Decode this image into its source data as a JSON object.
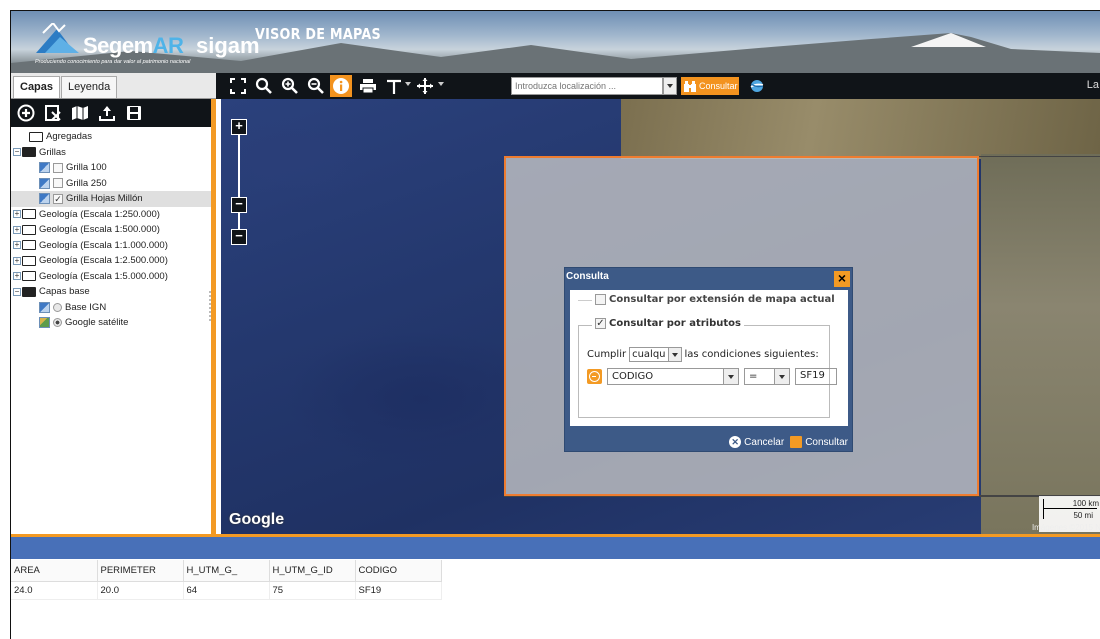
{
  "header": {
    "logo_segem": "Segem",
    "logo_ar": "AR",
    "logo_sigam": "sigam",
    "logo_tagline": "Produciendo conocimiento para dar valor al patrimonio nacional",
    "visor_title": "VISOR DE MAPAS"
  },
  "tabs": [
    {
      "label": "Capas"
    },
    {
      "label": "Leyenda"
    }
  ],
  "toolbar": {
    "location_placeholder": "Introduzca localización ...",
    "consultar_label": "Consultar",
    "right_truncated": "La"
  },
  "tree": [
    {
      "label": "Agregadas"
    },
    {
      "label": "Grillas"
    },
    {
      "label": "Grilla 100"
    },
    {
      "label": "Grilla 250"
    },
    {
      "label": "Grilla Hojas Millón"
    },
    {
      "label": "Geología (Escala 1:250.000)"
    },
    {
      "label": "Geología (Escala 1:500.000)"
    },
    {
      "label": "Geología (Escala 1:1.000.000)"
    },
    {
      "label": "Geología (Escala 1:2.500.000)"
    },
    {
      "label": "Geología (Escala 1:5.000.000)"
    },
    {
      "label": "Capas base"
    },
    {
      "label": "Base IGN"
    },
    {
      "label": "Google satélite"
    }
  ],
  "map": {
    "google_logo": "Google",
    "scale_km": "100 km",
    "scale_mi": "50 mi",
    "credit": "Imágenes ©2015 N"
  },
  "dialog": {
    "title": "Consulta",
    "opt_extent": "Consultar por extensión de mapa actual",
    "opt_attr": "Consultar por atributos",
    "cumplir": "Cumplir",
    "cumplir_value": "cualqu",
    "conditions_text": "las condiciones siguientes:",
    "field": "CODIGO",
    "operator": "=",
    "value": "SF19",
    "cancel": "Cancelar",
    "submit": "Consultar"
  },
  "results": {
    "columns": [
      "AREA",
      "PERIMETER",
      "H_UTM_G_",
      "H_UTM_G_ID",
      "CODIGO"
    ],
    "rows": [
      [
        "24.0",
        "20.0",
        "64",
        "75",
        "SF19"
      ]
    ]
  }
}
